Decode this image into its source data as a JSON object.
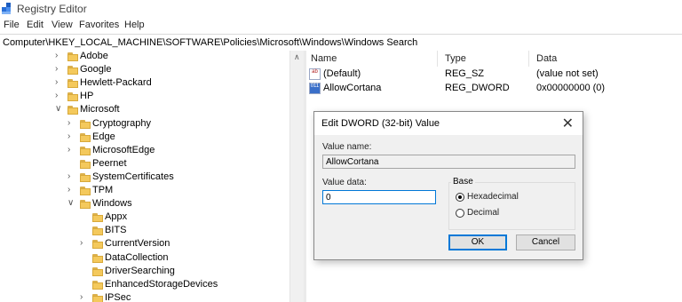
{
  "window": {
    "title": "Registry Editor"
  },
  "menu": [
    "File",
    "Edit",
    "View",
    "Favorites",
    "Help"
  ],
  "address": "Computer\\HKEY_LOCAL_MACHINE\\SOFTWARE\\Policies\\Microsoft\\Windows\\Windows Search",
  "tree": [
    {
      "label": "Adobe",
      "expander": ">"
    },
    {
      "label": "Google",
      "expander": ">"
    },
    {
      "label": "Hewlett-Packard",
      "expander": ">"
    },
    {
      "label": "HP",
      "expander": ">"
    },
    {
      "label": "Microsoft",
      "expander": "v"
    },
    {
      "label": "Cryptography",
      "expander": ">"
    },
    {
      "label": "Edge",
      "expander": ">"
    },
    {
      "label": "MicrosoftEdge",
      "expander": ">"
    },
    {
      "label": "Peernet",
      "expander": ""
    },
    {
      "label": "SystemCertificates",
      "expander": ">"
    },
    {
      "label": "TPM",
      "expander": ">"
    },
    {
      "label": "Windows",
      "expander": "v"
    },
    {
      "label": "Appx",
      "expander": ""
    },
    {
      "label": "BITS",
      "expander": ""
    },
    {
      "label": "CurrentVersion",
      "expander": ">"
    },
    {
      "label": "DataCollection",
      "expander": ""
    },
    {
      "label": "DriverSearching",
      "expander": ""
    },
    {
      "label": "EnhancedStorageDevices",
      "expander": ""
    },
    {
      "label": "IPSec",
      "expander": ">"
    }
  ],
  "values_pane": {
    "columns": [
      "Name",
      "Type",
      "Data"
    ],
    "rows": [
      {
        "icon": "string-value-icon",
        "icon_text": "ab",
        "name": "(Default)",
        "type": "REG_SZ",
        "data": "(value not set)"
      },
      {
        "icon": "dword-value-icon",
        "icon_text": "011",
        "name": "AllowCortana",
        "type": "REG_DWORD",
        "data": "0x00000000 (0)"
      }
    ]
  },
  "dialog": {
    "title": "Edit DWORD (32-bit) Value",
    "value_name_label": "Value name:",
    "value_name": "AllowCortana",
    "value_data_label": "Value data:",
    "value_data": "0",
    "base_label": "Base",
    "base_options": [
      "Hexadecimal",
      "Decimal"
    ],
    "base_selected": "Hexadecimal",
    "ok_label": "OK",
    "cancel_label": "Cancel"
  }
}
